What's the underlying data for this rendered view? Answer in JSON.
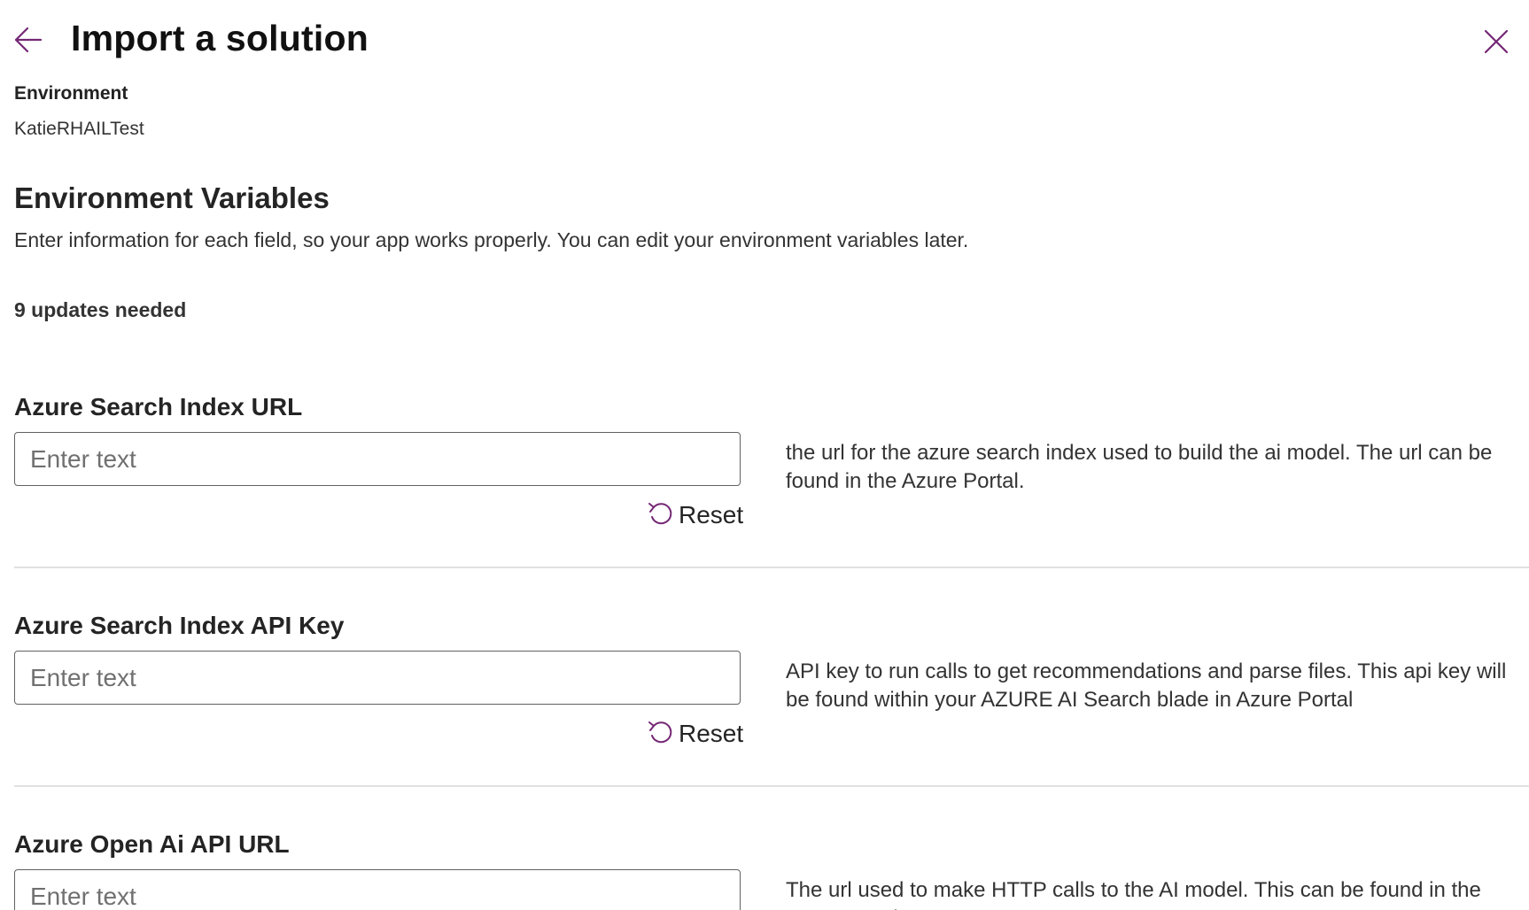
{
  "header": {
    "title": "Import a solution",
    "back_icon": "arrow-left-icon",
    "close_icon": "close-icon",
    "accent_color": "#742774"
  },
  "environment": {
    "label": "Environment",
    "value": "KatieRHAILTest"
  },
  "env_variables": {
    "title": "Environment Variables",
    "description": "Enter information for each field, so your app works properly. You can edit your environment variables later.",
    "updates_needed": "9 updates needed"
  },
  "variables": [
    {
      "label": "Azure Search Index URL",
      "placeholder": "Enter text",
      "description": "the url for the azure search index used to build the ai model. The url can be found in the Azure Portal.",
      "reset_label": "Reset"
    },
    {
      "label": "Azure Search Index API Key",
      "placeholder": "Enter text",
      "description": "API key to run calls to get recommendations and parse files. This api key will be found within your AZURE AI Search blade in Azure Portal",
      "reset_label": "Reset"
    },
    {
      "label": "Azure Open Ai API URL",
      "placeholder": "Enter text",
      "description": "The url used to make HTTP calls to the AI model. This can be found in the azure portal"
    }
  ]
}
